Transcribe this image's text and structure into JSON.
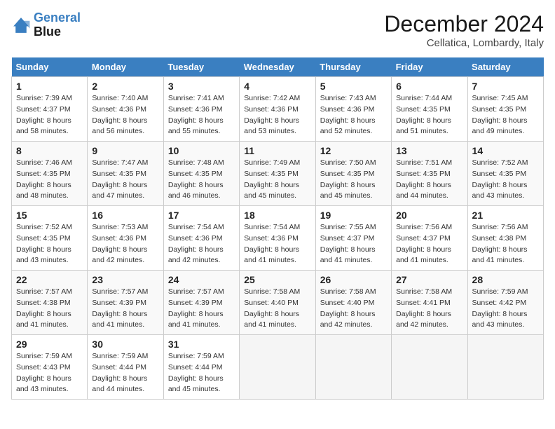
{
  "header": {
    "logo_line1": "General",
    "logo_line2": "Blue",
    "month": "December 2024",
    "location": "Cellatica, Lombardy, Italy"
  },
  "weekdays": [
    "Sunday",
    "Monday",
    "Tuesday",
    "Wednesday",
    "Thursday",
    "Friday",
    "Saturday"
  ],
  "weeks": [
    [
      {
        "day": "1",
        "sunrise": "7:39 AM",
        "sunset": "4:37 PM",
        "daylight": "8 hours and 58 minutes."
      },
      {
        "day": "2",
        "sunrise": "7:40 AM",
        "sunset": "4:36 PM",
        "daylight": "8 hours and 56 minutes."
      },
      {
        "day": "3",
        "sunrise": "7:41 AM",
        "sunset": "4:36 PM",
        "daylight": "8 hours and 55 minutes."
      },
      {
        "day": "4",
        "sunrise": "7:42 AM",
        "sunset": "4:36 PM",
        "daylight": "8 hours and 53 minutes."
      },
      {
        "day": "5",
        "sunrise": "7:43 AM",
        "sunset": "4:36 PM",
        "daylight": "8 hours and 52 minutes."
      },
      {
        "day": "6",
        "sunrise": "7:44 AM",
        "sunset": "4:35 PM",
        "daylight": "8 hours and 51 minutes."
      },
      {
        "day": "7",
        "sunrise": "7:45 AM",
        "sunset": "4:35 PM",
        "daylight": "8 hours and 49 minutes."
      }
    ],
    [
      {
        "day": "8",
        "sunrise": "7:46 AM",
        "sunset": "4:35 PM",
        "daylight": "8 hours and 48 minutes."
      },
      {
        "day": "9",
        "sunrise": "7:47 AM",
        "sunset": "4:35 PM",
        "daylight": "8 hours and 47 minutes."
      },
      {
        "day": "10",
        "sunrise": "7:48 AM",
        "sunset": "4:35 PM",
        "daylight": "8 hours and 46 minutes."
      },
      {
        "day": "11",
        "sunrise": "7:49 AM",
        "sunset": "4:35 PM",
        "daylight": "8 hours and 45 minutes."
      },
      {
        "day": "12",
        "sunrise": "7:50 AM",
        "sunset": "4:35 PM",
        "daylight": "8 hours and 45 minutes."
      },
      {
        "day": "13",
        "sunrise": "7:51 AM",
        "sunset": "4:35 PM",
        "daylight": "8 hours and 44 minutes."
      },
      {
        "day": "14",
        "sunrise": "7:52 AM",
        "sunset": "4:35 PM",
        "daylight": "8 hours and 43 minutes."
      }
    ],
    [
      {
        "day": "15",
        "sunrise": "7:52 AM",
        "sunset": "4:35 PM",
        "daylight": "8 hours and 43 minutes."
      },
      {
        "day": "16",
        "sunrise": "7:53 AM",
        "sunset": "4:36 PM",
        "daylight": "8 hours and 42 minutes."
      },
      {
        "day": "17",
        "sunrise": "7:54 AM",
        "sunset": "4:36 PM",
        "daylight": "8 hours and 42 minutes."
      },
      {
        "day": "18",
        "sunrise": "7:54 AM",
        "sunset": "4:36 PM",
        "daylight": "8 hours and 41 minutes."
      },
      {
        "day": "19",
        "sunrise": "7:55 AM",
        "sunset": "4:37 PM",
        "daylight": "8 hours and 41 minutes."
      },
      {
        "day": "20",
        "sunrise": "7:56 AM",
        "sunset": "4:37 PM",
        "daylight": "8 hours and 41 minutes."
      },
      {
        "day": "21",
        "sunrise": "7:56 AM",
        "sunset": "4:38 PM",
        "daylight": "8 hours and 41 minutes."
      }
    ],
    [
      {
        "day": "22",
        "sunrise": "7:57 AM",
        "sunset": "4:38 PM",
        "daylight": "8 hours and 41 minutes."
      },
      {
        "day": "23",
        "sunrise": "7:57 AM",
        "sunset": "4:39 PM",
        "daylight": "8 hours and 41 minutes."
      },
      {
        "day": "24",
        "sunrise": "7:57 AM",
        "sunset": "4:39 PM",
        "daylight": "8 hours and 41 minutes."
      },
      {
        "day": "25",
        "sunrise": "7:58 AM",
        "sunset": "4:40 PM",
        "daylight": "8 hours and 41 minutes."
      },
      {
        "day": "26",
        "sunrise": "7:58 AM",
        "sunset": "4:40 PM",
        "daylight": "8 hours and 42 minutes."
      },
      {
        "day": "27",
        "sunrise": "7:58 AM",
        "sunset": "4:41 PM",
        "daylight": "8 hours and 42 minutes."
      },
      {
        "day": "28",
        "sunrise": "7:59 AM",
        "sunset": "4:42 PM",
        "daylight": "8 hours and 43 minutes."
      }
    ],
    [
      {
        "day": "29",
        "sunrise": "7:59 AM",
        "sunset": "4:43 PM",
        "daylight": "8 hours and 43 minutes."
      },
      {
        "day": "30",
        "sunrise": "7:59 AM",
        "sunset": "4:44 PM",
        "daylight": "8 hours and 44 minutes."
      },
      {
        "day": "31",
        "sunrise": "7:59 AM",
        "sunset": "4:44 PM",
        "daylight": "8 hours and 45 minutes."
      },
      null,
      null,
      null,
      null
    ]
  ]
}
